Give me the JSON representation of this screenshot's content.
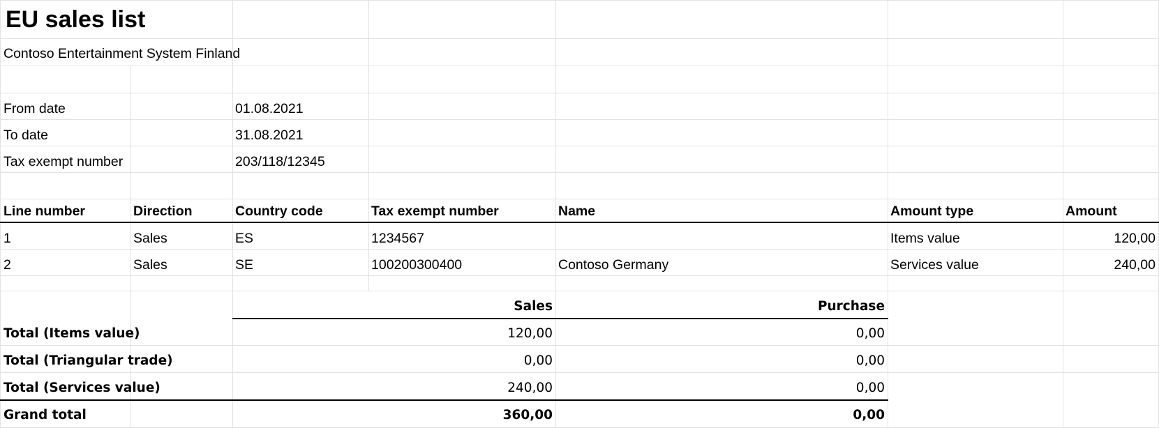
{
  "report": {
    "title": "EU sales list",
    "company": "Contoso Entertainment System Finland"
  },
  "parameters": {
    "from_date_label": "From date",
    "from_date_value": "01.08.2021",
    "to_date_label": "To date",
    "to_date_value": "31.08.2021",
    "tax_exempt_label": "Tax exempt number",
    "tax_exempt_value": "203/118/12345"
  },
  "table": {
    "headers": [
      "Line number",
      "Direction",
      "Country code",
      "Tax exempt number",
      "Name",
      "Amount type",
      "Amount"
    ],
    "rows": [
      [
        "1",
        "Sales",
        "ES",
        "1234567",
        "",
        "Items value",
        "120,00"
      ],
      [
        "2",
        "Sales",
        "SE",
        "100200300400",
        "Contoso Germany",
        "Services value",
        "240,00"
      ]
    ]
  },
  "totals": {
    "sales_header": "Sales",
    "purchase_header": "Purchase",
    "rows": [
      {
        "label": "Total (Items value)",
        "sales": "120,00",
        "purchase": "0,00"
      },
      {
        "label": "Total (Triangular trade)",
        "sales": "0,00",
        "purchase": "0,00"
      },
      {
        "label": "Total (Services value)",
        "sales": "240,00",
        "purchase": "0,00"
      }
    ],
    "grand": {
      "label": "Grand total",
      "sales": "360,00",
      "purchase": "0,00"
    }
  }
}
